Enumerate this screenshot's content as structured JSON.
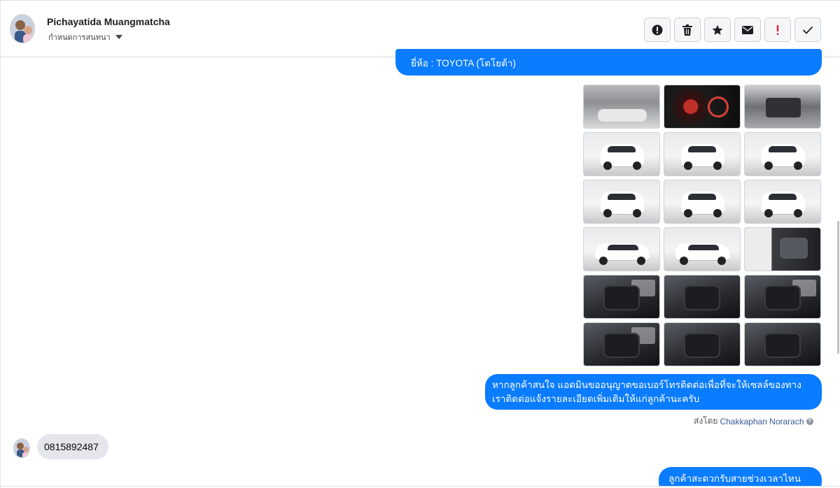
{
  "header": {
    "contact_name": "Pichayatida Muangmatcha",
    "conversation_settings": "กำหนดการสนทนา"
  },
  "toolbar": [
    {
      "name": "report-spam-button",
      "icon": "alert-circle-icon"
    },
    {
      "name": "delete-button",
      "icon": "trash-icon"
    },
    {
      "name": "star-button",
      "icon": "star-icon"
    },
    {
      "name": "mark-unread-button",
      "icon": "envelope-icon"
    },
    {
      "name": "mark-important-button",
      "icon": "exclamation-icon"
    },
    {
      "name": "mark-done-button",
      "icon": "checkmark-icon"
    }
  ],
  "colors": {
    "outgoing_bubble": "#0a7cff",
    "incoming_bubble": "#e4e6eb",
    "important_red": "#e41e3f",
    "link_blue": "#385898"
  },
  "messages": {
    "brand_line": "ยี่ห้อ : TOYOTA (โตโยต้า)",
    "contact_request": "หากลูกค้าสนใจ แอดมินขออนุญาตขอเบอร์โทรติดต่อเพื่อที่จะให้เซลล์ของทางเราติดต่อแจ้งรายละเอียดเพิ่มเติมให้แก่ลูกค้านะครับ",
    "sent_by_label": "ส่งโดย",
    "sent_by_name": "Chakkaphan Norarach",
    "customer_reply": "0815892487",
    "partial_next": "ลูกค้าสะดวกรับสายช่วงเวลาไหนครับ"
  },
  "gallery": [
    "cabin-photo",
    "dashboard-photo",
    "engine-photo",
    "front-photo",
    "front-photo",
    "front-photo",
    "rear-photo",
    "rear-photo",
    "rear-photo",
    "side-photo",
    "side-photo",
    "door-photo",
    "interior-photo",
    "interior-photo",
    "interior-photo",
    "interior-photo",
    "interior-photo",
    "interior-photo"
  ]
}
